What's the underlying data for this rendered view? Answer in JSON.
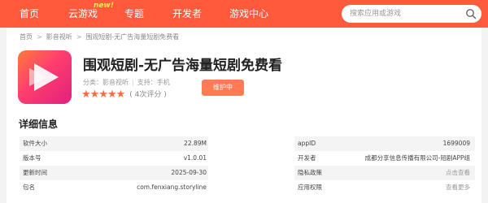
{
  "nav": {
    "items": [
      {
        "label": "首页"
      },
      {
        "label": "云游戏"
      },
      {
        "label": "专题"
      },
      {
        "label": "开发者"
      },
      {
        "label": "游戏中心"
      }
    ],
    "new_badge": "new!"
  },
  "search": {
    "placeholder": "搜索应用或游戏"
  },
  "breadcrumb": [
    "首页",
    "影音视听",
    "围观短剧-无广告海量短剧免费看"
  ],
  "app": {
    "title": "围观短剧-无广告海量短剧免费看",
    "category_label": "分类：",
    "category": "影音视听",
    "support_label": "支持：",
    "support": "手机",
    "rating_stars": 5,
    "rating_count": "( 4次评分 )",
    "status_button": "维护中"
  },
  "details": {
    "section_title": "详细信息",
    "left": [
      {
        "label": "软件大小",
        "value": "22.89M"
      },
      {
        "label": "版本号",
        "value": "v1.0.01"
      },
      {
        "label": "更新时间",
        "value": "2025-09-30"
      },
      {
        "label": "包名",
        "value": "com.fenxiang.storyline"
      }
    ],
    "right": [
      {
        "label": "appID",
        "value": "1699009"
      },
      {
        "label": "开发者",
        "value": "成都分享信息传播有限公司-短剧APP组"
      },
      {
        "label": "隐私政策",
        "value": "点击查看"
      },
      {
        "label": "应用权限",
        "value": "查看更多"
      }
    ]
  },
  "colors": {
    "brand": "#ff5a3c",
    "button": "#ff7a55",
    "star": "#ff6a3c"
  }
}
